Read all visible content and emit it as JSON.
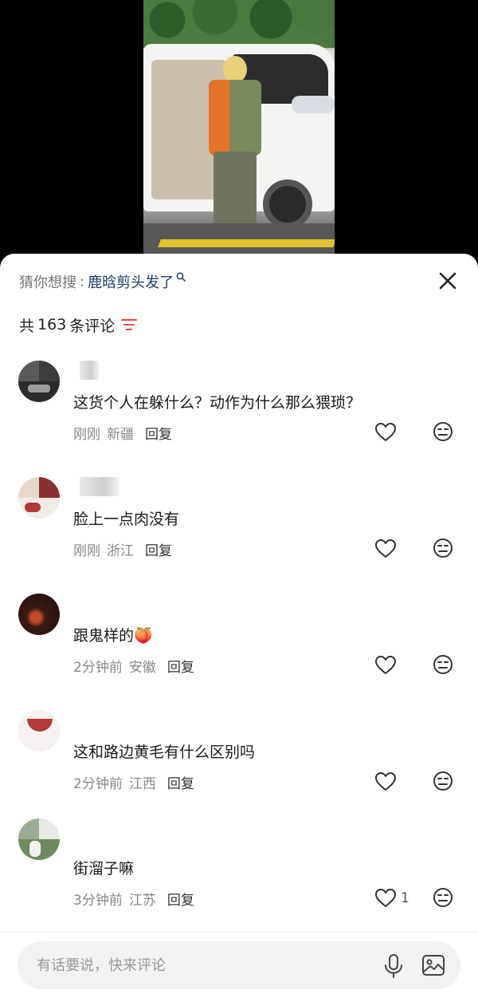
{
  "guess": {
    "label": "猜你想搜",
    "separator": ":",
    "query": "鹿晗剪头发了"
  },
  "comment_count": {
    "prefix": "共",
    "number": "163",
    "suffix": "条评论"
  },
  "comments": [
    {
      "text": "这货个人在躲什么？动作为什么那么猥琐？",
      "time": "刚刚",
      "location": "新疆",
      "reply": "回复",
      "likes": ""
    },
    {
      "text": "脸上一点肉没有",
      "time": "刚刚",
      "location": "浙江",
      "reply": "回复",
      "likes": ""
    },
    {
      "text": "跟鬼样的🍑",
      "time": "2分钟前",
      "location": "安徽",
      "reply": "回复",
      "likes": ""
    },
    {
      "text": "这和路边黄毛有什么区别吗",
      "time": "2分钟前",
      "location": "江西",
      "reply": "回复",
      "likes": ""
    },
    {
      "text": "街溜子嘛",
      "time": "3分钟前",
      "location": "江苏",
      "reply": "回复",
      "likes": "1"
    }
  ],
  "input": {
    "placeholder": "有话要说，快来评论"
  },
  "colors": {
    "query_text": "#1f3a6a",
    "filter_icon": "#e04848",
    "sheet_bg": "#ffffff",
    "input_bg": "#f2f2f3"
  },
  "icons": [
    "search-icon",
    "close-icon",
    "filter-icon",
    "heart-icon",
    "dislike-face-icon",
    "mic-icon",
    "image-icon"
  ]
}
